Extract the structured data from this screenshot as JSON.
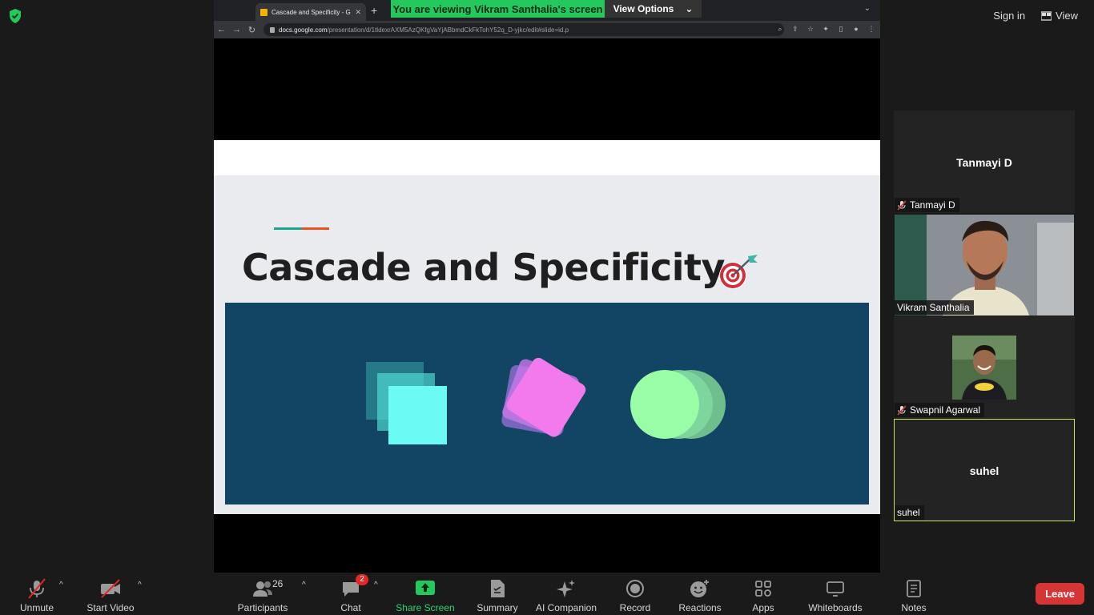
{
  "top_bar": {
    "sign_in_label": "Sign in",
    "view_label": "View"
  },
  "banner": {
    "message": "You are viewing Vikram Santhalia's screen",
    "view_options_label": "View Options"
  },
  "browser": {
    "tab_title": "Cascade and Specificity - Goo",
    "url_host": "docs.google.com",
    "url_path": "/presentation/d/1tldexrAXM5AzQKfgVaYjABbmdCkFkTohY52q_D-yjkc/edit#slide=id.p"
  },
  "slide": {
    "title": "Cascade and Specificity",
    "accent_colors": [
      "#1aa68b",
      "#e8541c"
    ],
    "panel_color": "#124463"
  },
  "participants_panel": {
    "tiles": [
      {
        "display_name": "Tanmayi D",
        "tag_name": "Tanmayi D",
        "muted": true
      },
      {
        "tag_name": "Vikram Santhalia",
        "muted": false
      },
      {
        "tag_name": "Swapnil Agarwal",
        "muted": true
      },
      {
        "display_name": "suhel",
        "tag_name": "suhel",
        "muted": false,
        "active_speaker": true
      }
    ]
  },
  "toolbar": {
    "unmute_label": "Unmute",
    "start_video_label": "Start Video",
    "participants_label": "Participants",
    "participants_count": "26",
    "chat_label": "Chat",
    "chat_badge": "2",
    "share_screen_label": "Share Screen",
    "summary_label": "Summary",
    "ai_companion_label": "AI Companion",
    "record_label": "Record",
    "reactions_label": "Reactions",
    "apps_label": "Apps",
    "whiteboards_label": "Whiteboards",
    "notes_label": "Notes",
    "leave_label": "Leave"
  },
  "colors": {
    "share_green": "#23c95c",
    "leave_red": "#d73535",
    "active_speaker_border": "#c3e84a"
  }
}
